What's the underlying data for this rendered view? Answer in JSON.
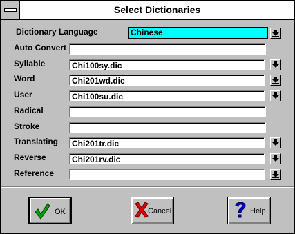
{
  "window": {
    "title": "Select Dictionaries"
  },
  "language": {
    "label": "Dictionary Language",
    "value": "Chinese"
  },
  "fields": {
    "auto_convert": {
      "label": "Auto Convert",
      "value": ""
    },
    "syllable": {
      "label": "Syllable",
      "value": "Chi100sy.dic"
    },
    "word": {
      "label": "Word",
      "value": "Chi201wd.dic"
    },
    "user": {
      "label": "User",
      "value": "Chi100su.dic"
    },
    "radical": {
      "label": "Radical",
      "value": ""
    },
    "stroke": {
      "label": "Stroke",
      "value": ""
    },
    "translating": {
      "label": "Translating",
      "value": "Chi201tr.dic"
    },
    "reverse": {
      "label": "Reverse",
      "value": "Chi201rv.dic"
    },
    "reference": {
      "label": "Reference",
      "value": ""
    }
  },
  "buttons": {
    "ok": "OK",
    "cancel": "Cancel",
    "help": "Help"
  },
  "icons": {
    "ok": "checkmark-icon",
    "cancel": "x-icon",
    "help": "question-icon",
    "dropdown": "dropdown-arrow-icon",
    "system_menu": "system-menu-icon"
  },
  "colors": {
    "selection": "#00ffff",
    "face": "#c0c0c0",
    "ok_check": "#00a000",
    "cancel_x": "#e00000",
    "help_q": "#0000c0"
  }
}
